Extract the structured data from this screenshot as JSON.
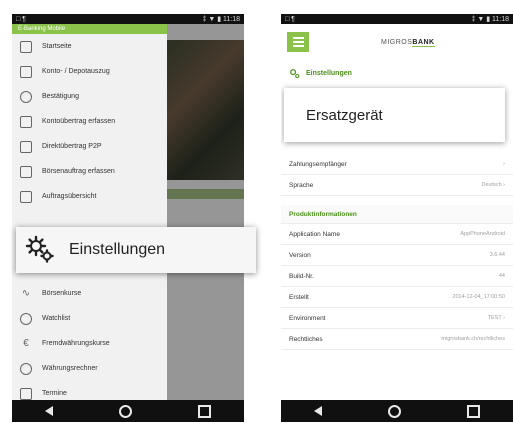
{
  "left_screen": {
    "status": {
      "left": "□ ¶",
      "right": "‡ ▼ ▮ 11:18"
    },
    "drawer_header": "E-Banking Mobile",
    "drawer_items": [
      {
        "icon": "home-icon",
        "label": "Startseite"
      },
      {
        "icon": "account-statement-icon",
        "label": "Konto- / Depotauszug"
      },
      {
        "icon": "confirmation-icon",
        "label": "Bestätigung"
      },
      {
        "icon": "transfer-icon",
        "label": "Kontoübertrag erfassen"
      },
      {
        "icon": "p2p-icon",
        "label": "Direktübertrag P2P"
      },
      {
        "icon": "stock-order-icon",
        "label": "Börsenauftrag erfassen"
      },
      {
        "icon": "orders-icon",
        "label": "Auftragsübersicht"
      }
    ],
    "drawer_items_bottom": [
      {
        "icon": "chart-icon",
        "label": "Börsenkurse"
      },
      {
        "icon": "watchlist-icon",
        "label": "Watchlist"
      },
      {
        "icon": "currency-icon",
        "label": "Fremdwährungskurse"
      },
      {
        "icon": "calculator-icon",
        "label": "Währungsrechner"
      },
      {
        "icon": "deadlines-icon",
        "label": "Termine"
      }
    ],
    "popup_label": "Einstellungen"
  },
  "right_screen": {
    "status": {
      "left": "□ ¶",
      "right": "‡ ▼ ▮ 11:18"
    },
    "logo": {
      "pre": "MIGROS",
      "bank": "BANK"
    },
    "section_title": "Einstellungen",
    "dialog_text": "Ersatzgerät",
    "rows_top": [
      {
        "label": "Zahlungsempfänger",
        "value": "›"
      },
      {
        "label": "Sprache",
        "value": "Deutsch ›"
      }
    ],
    "product_header": "Produktinformationen",
    "rows_product": [
      {
        "label": "Application Name",
        "value": "AppPhoneAndroid"
      },
      {
        "label": "Version",
        "value": "3.6.44"
      },
      {
        "label": "Build-Nr.",
        "value": "44"
      },
      {
        "label": "Erstellt",
        "value": "2014-12-04_17:00:50"
      },
      {
        "label": "Environment",
        "value": "TEST ›"
      },
      {
        "label": "Rechtliches",
        "value": "migrosbank.ch/rechtliches"
      }
    ]
  },
  "colors": {
    "accent": "#8bc34a",
    "accent_dark": "#4c8f1a"
  }
}
